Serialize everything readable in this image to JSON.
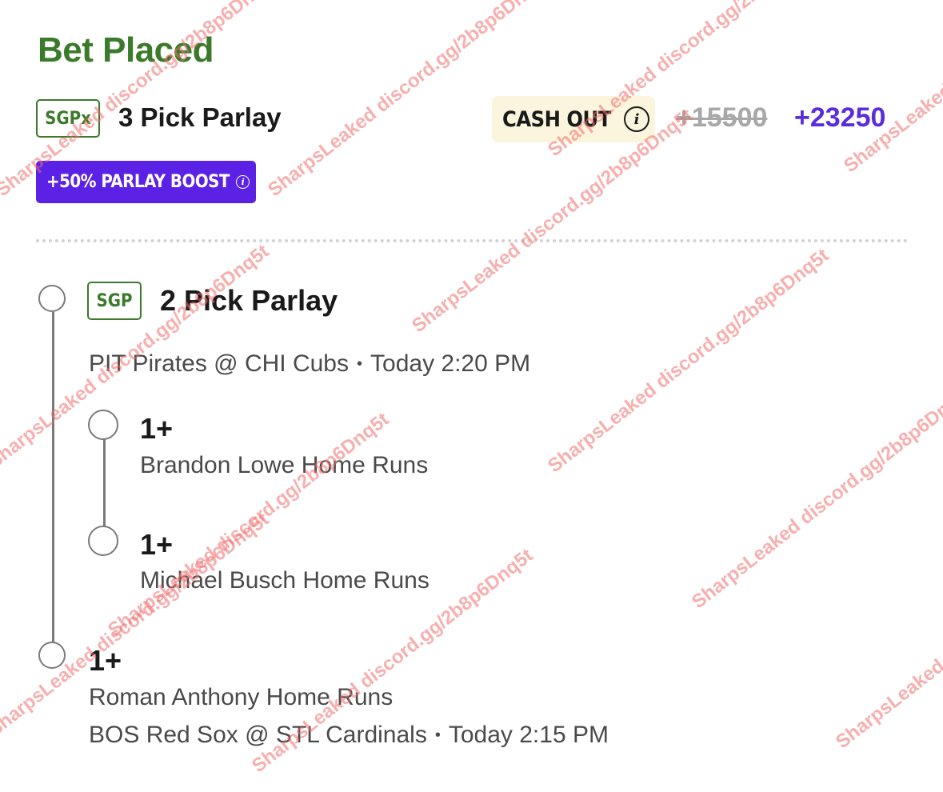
{
  "header": {
    "title": "Bet Placed",
    "parlay_badge": "SGPx",
    "parlay_title": "3 Pick Parlay",
    "cash_out_label": "CASH OUT",
    "odds_original": "+15500",
    "odds_boosted": "+23250",
    "boost_label": "+50% PARLAY BOOST"
  },
  "sub_parlay": {
    "badge": "SGP",
    "title": "2 Pick Parlay",
    "game": "PIT Pirates @ CHI Cubs",
    "time": "Today 2:20 PM",
    "legs": [
      {
        "line": "1+",
        "description": "Brandon Lowe Home Runs"
      },
      {
        "line": "1+",
        "description": "Michael Busch Home Runs"
      }
    ]
  },
  "single_leg": {
    "line": "1+",
    "description": "Roman Anthony Home Runs",
    "game": "BOS Red Sox @ STL Cardinals",
    "time": "Today 2:15 PM"
  },
  "watermark": "SharpsLeaked discord.gg/2b8p6Dnq5t",
  "colors": {
    "title_green": "#3b7a2a",
    "boost_purple": "#5b22e6",
    "boosted_odds_purple": "#5a2ddb",
    "cash_out_bg": "#fbf5dd",
    "watermark": "#f06e6e"
  }
}
